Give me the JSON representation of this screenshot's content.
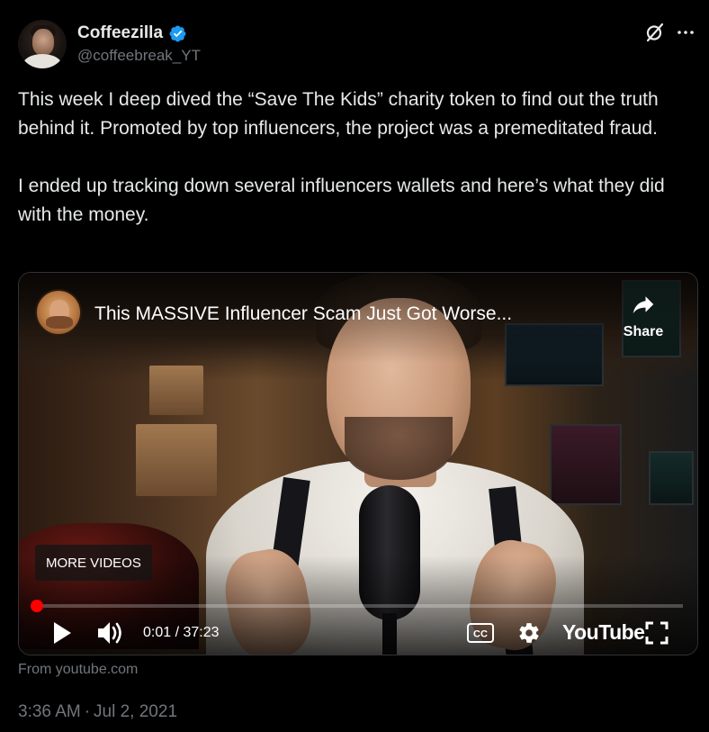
{
  "author": {
    "display_name": "Coffeezilla",
    "handle": "@coffeebreak_YT",
    "verified": true,
    "avatar_icon": "profile-avatar"
  },
  "header_actions": {
    "grok_icon": "grok-icon",
    "more_icon": "more-icon"
  },
  "tweet": {
    "paragraph_1": "This week I deep dived the “Save The Kids” charity token to find out the truth behind it. Promoted by top influencers, the project was a premeditated fraud.",
    "paragraph_2": "I ended up tracking down several influencers wallets and here’s what they did with the money."
  },
  "video": {
    "title": "This MASSIVE Influencer Scam Just Got Worse...",
    "share_label": "Share",
    "more_videos_label": "MORE VIDEOS",
    "current_time": "0:01",
    "duration": "37:23",
    "time_display": "0:01 / 37:23",
    "progress_fraction": 0.0004,
    "youtube_label": "YouTube",
    "accent_color": "#ff0000"
  },
  "card_source": "From youtube.com",
  "meta": {
    "time": "3:36 AM",
    "separator": "·",
    "date": "Jul 2, 2021"
  },
  "colors": {
    "background": "#000000",
    "primary_text": "#e7e9ea",
    "secondary_text": "#71767b",
    "verified_blue": "#1d9bf0"
  }
}
